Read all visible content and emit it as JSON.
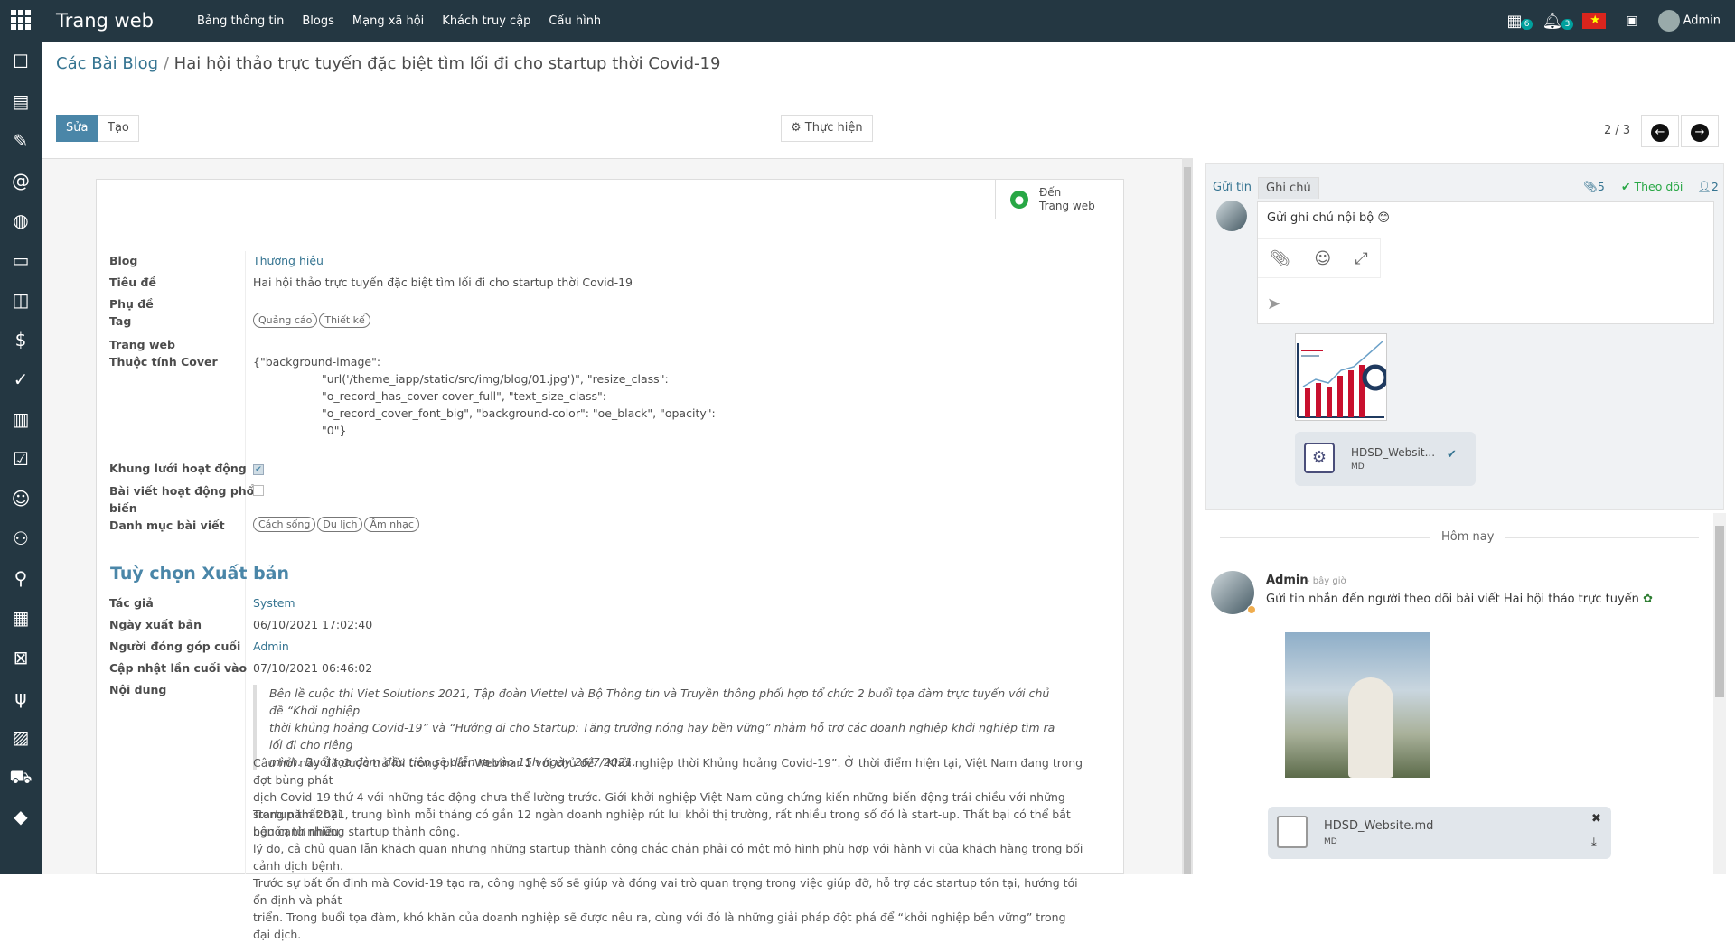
{
  "topbar": {
    "brand": "Trang web",
    "menu": [
      "Bảng thông tin",
      "Blogs",
      "Mạng xã hội",
      "Khách truy cập",
      "Cấu hình"
    ],
    "activity_count": "6",
    "notification_count": "3",
    "user": "Admin"
  },
  "sidebar": {
    "icons": [
      "discuss-icon",
      "calendar-icon",
      "notes-icon",
      "email-marketing-icon",
      "website-icon",
      "elearning-icon",
      "events-icon",
      "invoicing-icon",
      "project-icon",
      "planning-icon",
      "survey-icon",
      "emoji-icon",
      "contacts-icon",
      "employees-icon",
      "timesheet-icon",
      "leave-icon",
      "lunch-icon",
      "dashboard-icon",
      "cart-icon",
      "tag-icon",
      "bank-icon"
    ]
  },
  "breadcrumb": {
    "parent": "Các Bài Blog",
    "separator": "/",
    "current": "Hai hội thảo trực tuyến đặc biệt tìm lối đi cho startup thời Covid-19"
  },
  "controls": {
    "edit": "Sửa",
    "create": "Tạo",
    "action": "Thực hiện",
    "pager": "2 / 3"
  },
  "stat_button": {
    "line1": "Đến",
    "line2": "Trang web"
  },
  "form": {
    "blog_label": "Blog",
    "blog_value": "Thương hiệu",
    "title_label": "Tiêu đề",
    "title_value": "Hai hội thảo trực tuyến đặc biệt tìm lối đi cho startup thời Covid-19",
    "subtitle_label": "Phụ đề",
    "tag_label": "Tag",
    "tags": [
      "Quảng cáo",
      "Thiết kế"
    ],
    "website_label": "Trang web",
    "cover_label": "Thuộc tính Cover",
    "cover_lines": [
      "{\"background-image\":",
      "\"url('/theme_iapp/static/src/img/blog/01.jpg')\", \"resize_class\":",
      "\"o_record_has_cover cover_full\", \"text_size_class\":",
      "\"o_record_cover_font_big\", \"background-color\": \"oe_black\", \"opacity\":",
      "\"0\"}"
    ],
    "grid_label": "Khung lưới hoạt động",
    "popular_label_1": "Bài viết hoạt động phổ",
    "popular_label_2": "biến",
    "category_label": "Danh mục bài viết",
    "categories": [
      "Cách sống",
      "Du lịch",
      "Âm nhạc"
    ],
    "publish_section": "Tuỳ chọn Xuất bản",
    "author_label": "Tác giả",
    "author_value": "System",
    "publish_date_label": "Ngày xuất bản",
    "publish_date_value": "06/10/2021 17:02:40",
    "contributor_label": "Người đóng góp cuối",
    "contributor_value": "Admin",
    "updated_label": "Cập nhật lần cuối vào",
    "updated_value": "07/10/2021 06:46:02",
    "content_label": "Nội dung",
    "quote_lines": [
      "Bên lề cuộc thi Viet Solutions 2021, Tập đoàn Viettel và Bộ Thông tin và Truyền thông phối hợp tổ chức 2 buổi tọa đàm trực tuyến với chủ đề “Khởi nghiệp",
      "thời khủng hoảng Covid-19” và “Hướng đi cho Startup: Tăng trưởng nóng hay bền vững” nhằm hỗ trợ các doanh nghiệp khởi nghiệp tìm ra lối đi cho riêng",
      "mình. Buổi tọa đàm đầu tiên sẽ diễn ra vào 15h ngày 26/7/2021."
    ],
    "para1_lines": [
      "Câu hỏi này đã được trả lời trong phần Webinar 1 với chủ đề: “Khởi nghiệp thời Khủng hoảng Covid-19”. Ở thời điểm hiện tại, Việt Nam đang trong đợt bùng phát",
      "dịch Covid-19 thứ 4 với những tác động chưa thể lường trước. Giới khởi nghiệp Việt Nam cũng chứng kiến những biến động trái chiều với những startup thất bại",
      "bên cạnh những startup thành công."
    ],
    "para2_lines": [
      "Trong năm 2021, trung bình mỗi tháng có gần 12 ngàn doanh nghiệp rút lui khỏi thị trường, rất nhiều trong số đó là start-up. Thất bại có thể bắt nguồn từ nhiều",
      "lý do, cả chủ quan lẫn khách quan nhưng những startup thành công chắc chắn phải có một mô hình phù hợp với hành vi của khách hàng trong bối cảnh dịch bệnh.",
      "Trước sự bất ổn định mà Covid-19 tạo ra, công nghệ số sẽ giúp và đóng vai trò quan trọng trong việc giúp đỡ, hỗ trợ các startup tồn tại, hướng tới ổn định và phát",
      "triển. Trong buổi tọa đàm, khó khăn của doanh nghiệp sẽ được nêu ra, cùng với đó là những giải pháp đột phá để “khởi nghiệp bền vững” trong đại dịch."
    ]
  },
  "chatter": {
    "tab_send": "Gửi tin",
    "tab_note": "Ghi chú",
    "attachments": "5",
    "follow": "Theo dõi",
    "followers": "2",
    "composer_text": "Gửi ghi chú nội bộ 😊",
    "draft_file_name": "HDSD_Websit...",
    "draft_file_type": "MD",
    "today": "Hôm nay",
    "msg_author": "Admin",
    "msg_time": "- bây giờ",
    "msg_body": "Gửi tin nhắn đến người theo dõi bài viết Hai hội thảo trực tuyến",
    "file_name": "HDSD_Website.md",
    "file_type": "MD"
  }
}
